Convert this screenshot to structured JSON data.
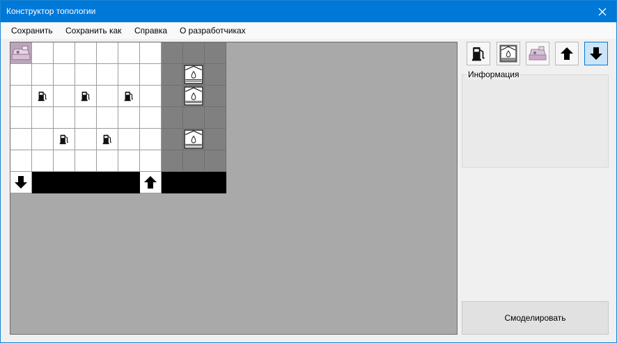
{
  "window": {
    "title": "Конструктор топологии"
  },
  "menu": {
    "save": "Сохранить",
    "save_as": "Сохранить как",
    "help": "Справка",
    "about": "О разработчиках"
  },
  "info": {
    "legend": "Информация"
  },
  "actions": {
    "simulate": "Смоделировать"
  },
  "toolbar": {
    "tools": [
      "fuel-pump",
      "fuel-tank",
      "cash-register",
      "arrow-up",
      "arrow-down"
    ],
    "selected": "arrow-down"
  },
  "grid": {
    "rows": 7,
    "cols": 10,
    "cells": [
      [
        "cash-register",
        "empty",
        "empty",
        "empty",
        "empty",
        "empty",
        "empty",
        "tank-zone",
        "tank-zone",
        "tank-zone"
      ],
      [
        "empty",
        "empty",
        "empty",
        "empty",
        "empty",
        "empty",
        "empty",
        "tank-zone",
        "fuel-tank",
        "tank-zone"
      ],
      [
        "empty",
        "fuel-pump",
        "empty",
        "fuel-pump",
        "empty",
        "fuel-pump",
        "empty",
        "tank-zone",
        "fuel-tank",
        "tank-zone"
      ],
      [
        "empty",
        "empty",
        "empty",
        "empty",
        "empty",
        "empty",
        "empty",
        "tank-zone",
        "tank-zone",
        "tank-zone"
      ],
      [
        "empty",
        "empty",
        "fuel-pump",
        "empty",
        "fuel-pump",
        "empty",
        "empty",
        "tank-zone",
        "fuel-tank",
        "tank-zone"
      ],
      [
        "empty",
        "empty",
        "empty",
        "empty",
        "empty",
        "empty",
        "empty",
        "tank-zone",
        "tank-zone",
        "tank-zone"
      ],
      [
        "arrow-down",
        "road",
        "road",
        "road",
        "road",
        "road",
        "arrow-up",
        "road",
        "road",
        "road"
      ]
    ]
  }
}
